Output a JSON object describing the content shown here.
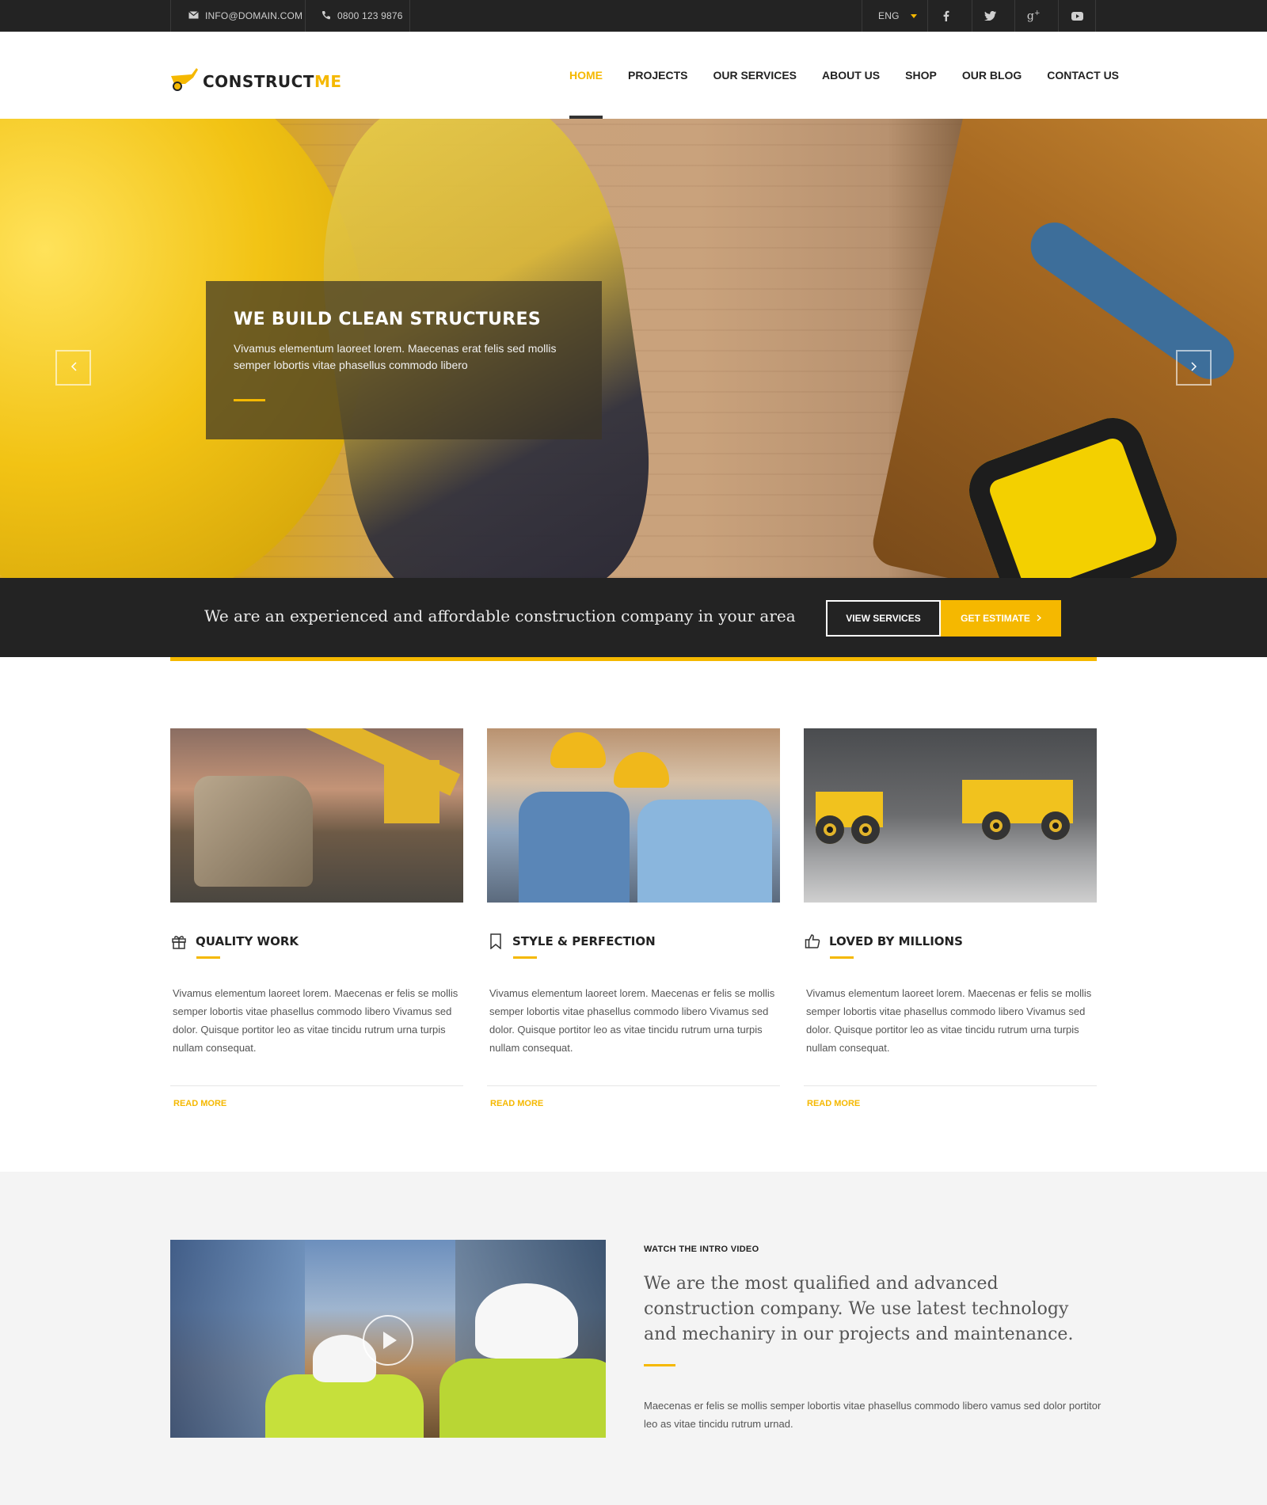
{
  "topbar": {
    "email": "INFO@DOMAIN.COM",
    "phone": "0800 123 9876",
    "language": "ENG",
    "social": [
      "facebook-icon",
      "twitter-icon",
      "google-plus-icon",
      "youtube-icon"
    ]
  },
  "brand": {
    "name_main": "CONSTRUCT",
    "name_accent": "ME",
    "accent_color": "#f5b800"
  },
  "nav": {
    "items": [
      {
        "label": "HOME",
        "active": true
      },
      {
        "label": "PROJECTS"
      },
      {
        "label": "OUR SERVICES"
      },
      {
        "label": "ABOUT US"
      },
      {
        "label": "SHOP"
      },
      {
        "label": "OUR BLOG"
      },
      {
        "label": "CONTACT US"
      }
    ]
  },
  "hero": {
    "title": "WE BUILD CLEAN STRUCTURES",
    "text": "Vivamus elementum laoreet lorem. Maecenas erat felis sed mollis semper lobortis vitae phasellus commodo libero"
  },
  "band": {
    "text": "We are an experienced and affordable construction company in your area",
    "view_services": "VIEW SERVICES",
    "get_estimate": "GET ESTIMATE"
  },
  "features": [
    {
      "icon": "gift-icon",
      "title": "QUALITY WORK",
      "text": "Vivamus elementum laoreet lorem. Maecenas er felis se mollis semper lobortis vitae phasellus commodo libero Vivamus sed dolor. Quisque portitor leo as vitae tincidu rutrum urna turpis nullam consequat.",
      "more": "READ MORE"
    },
    {
      "icon": "bookmark-icon",
      "title": "STYLE & PERFECTION",
      "text": "Vivamus elementum laoreet lorem. Maecenas er felis se mollis semper lobortis vitae phasellus commodo libero Vivamus sed dolor. Quisque portitor leo as vitae tincidu rutrum urna turpis nullam consequat.",
      "more": "READ MORE"
    },
    {
      "icon": "thumbs-up-icon",
      "title": "LOVED BY MILLIONS",
      "text": "Vivamus elementum laoreet lorem. Maecenas er felis se mollis semper lobortis vitae phasellus commodo libero Vivamus sed dolor. Quisque portitor leo as vitae tincidu rutrum urna turpis nullam consequat.",
      "more": "READ MORE"
    }
  ],
  "video": {
    "eyebrow": "WATCH THE INTRO VIDEO",
    "title": "We are the most qualified and advanced construction company. We use latest technology and mechaniry in our projects and maintenance.",
    "text": "Maecenas er felis se mollis semper lobortis vitae phasellus commodo libero vamus sed dolor portitor leo as vitae tincidu rutrum urnad."
  }
}
